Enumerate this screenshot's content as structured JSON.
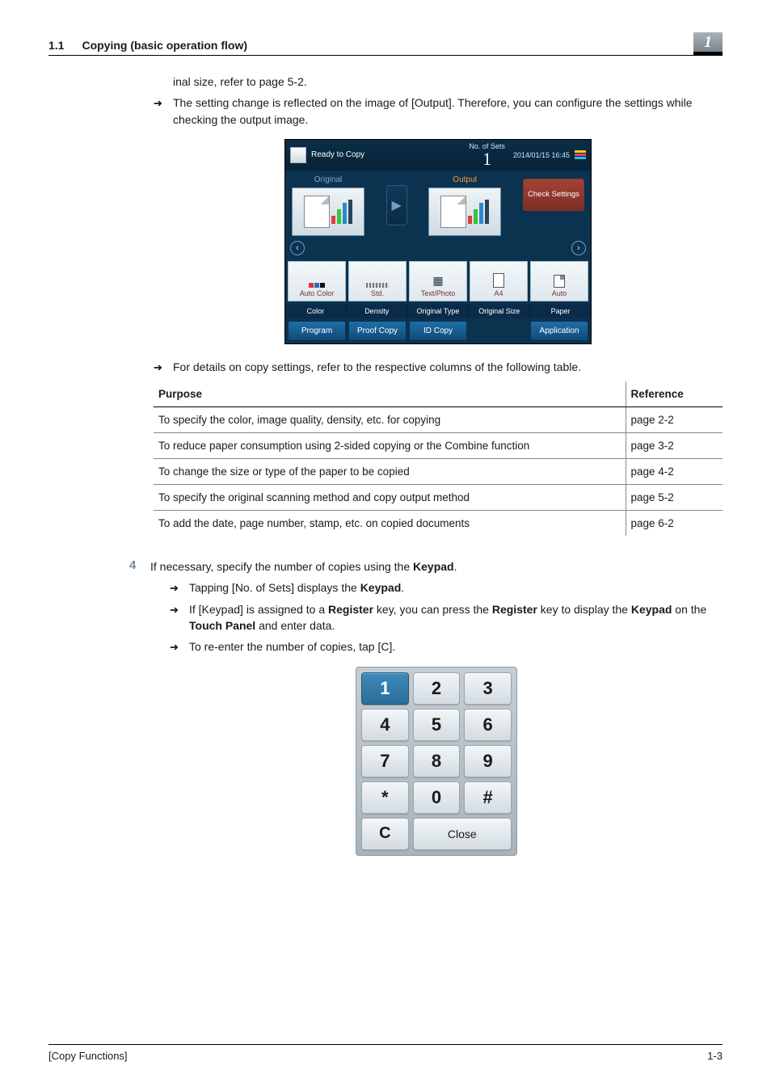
{
  "header": {
    "sec_num": "1.1",
    "sec_title": "Copying (basic operation flow)",
    "chapter_number": "1"
  },
  "frag_line": "inal size, refer to page 5-2.",
  "bullet_output_setting": "The setting change is reflected on the image of [Output]. Therefore, you can configure the settings while checking the output image.",
  "panel": {
    "ready": "Ready to Copy",
    "sets_label": "No. of Sets",
    "sets_value": "1",
    "timestamp": "2014/01/15 16:45",
    "original_label": "Original",
    "output_label": "Output",
    "check_settings": "Check Settings",
    "options_values": [
      "Auto Color",
      "Std.",
      "Text/Photo",
      "A4",
      "Auto"
    ],
    "options_labels": [
      "Color",
      "Density",
      "Original Type",
      "Original Size",
      "Paper"
    ],
    "bottom_buttons": [
      "Program",
      "Proof Copy",
      "ID Copy",
      "Application"
    ]
  },
  "bullet_table_intro": "For details on copy settings, refer to the respective columns of the following table.",
  "table": {
    "head_purpose": "Purpose",
    "head_reference": "Reference",
    "rows": [
      {
        "purpose": "To specify the color, image quality, density, etc. for copying",
        "ref": "page 2-2"
      },
      {
        "purpose": "To reduce paper consumption using 2-sided copying or the Combine function",
        "ref": "page 3-2"
      },
      {
        "purpose": "To change the size or type of the paper to be copied",
        "ref": "page 4-2"
      },
      {
        "purpose": "To specify the original scanning method and copy output method",
        "ref": "page 5-2"
      },
      {
        "purpose": "To add the date, page number, stamp, etc. on copied documents",
        "ref": "page 6-2"
      }
    ]
  },
  "step4": {
    "num": "4",
    "lead_pre": "If necessary, specify the number of copies using the ",
    "lead_kw": "Keypad",
    "lead_post": ".",
    "b1_pre": "Tapping [No. of Sets] displays the ",
    "b1_kw": "Keypad",
    "b1_post": ".",
    "b2_pre": "If [Keypad] is assigned to a ",
    "b2_k1": "Register",
    "b2_mid1": " key, you can press the ",
    "b2_k2": "Register",
    "b2_mid2": " key to display the ",
    "b2_k3": "Keypad",
    "b2_mid3": " on the ",
    "b2_k4": "Touch Panel",
    "b2_post": " and enter data.",
    "b3": "To re-enter the number of copies, tap [C]."
  },
  "keypad": {
    "keys": [
      "1",
      "2",
      "3",
      "4",
      "5",
      "6",
      "7",
      "8",
      "9",
      "*",
      "0",
      "#"
    ],
    "c": "C",
    "close": "Close"
  },
  "footer": {
    "left": "[Copy Functions]",
    "right": "1-3"
  }
}
